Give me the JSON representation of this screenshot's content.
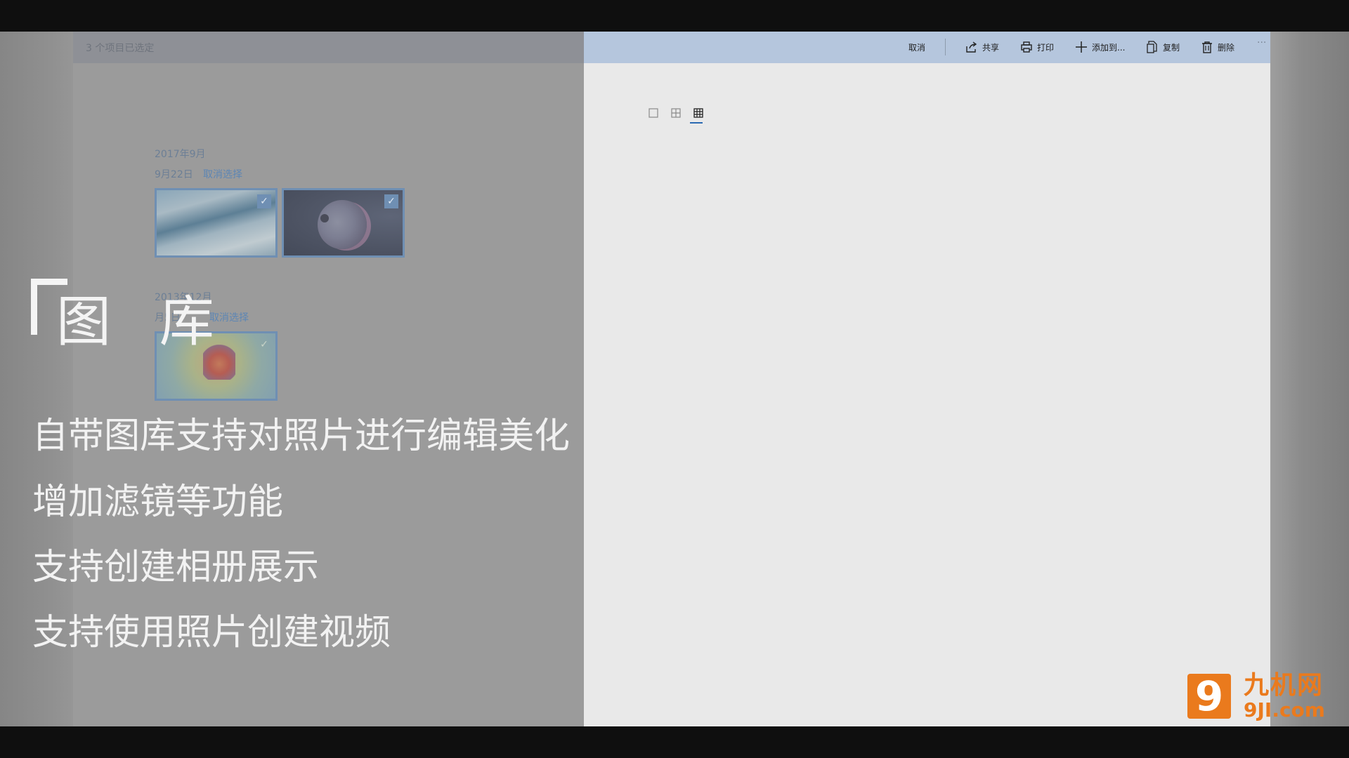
{
  "left_panel": {
    "selected_count": "3 个项目已选定",
    "groups": [
      {
        "title": "2017年9月",
        "day": "9月22日",
        "deselect": "取消选择"
      },
      {
        "title": "2013年12月",
        "day": "月5日",
        "deselect": "取消选择"
      }
    ],
    "check_glyph": "✓"
  },
  "toolbar": {
    "cancel": "取消",
    "share": "共享",
    "print": "打印",
    "add_to": "添加到...",
    "copy": "复制",
    "delete": "删除",
    "more": "···",
    "icons": [
      "share-icon",
      "print-icon",
      "add-icon",
      "copy-icon",
      "delete-icon"
    ]
  },
  "view_toggle": {
    "options": [
      "single-view-icon",
      "medium-grid-icon",
      "small-grid-icon"
    ],
    "active": "small-grid-icon",
    "accent": "#2a69b2"
  },
  "overlay": {
    "title": "图 库",
    "lines": [
      "自带图库支持对照片进行编辑美化",
      "增加滤镜等功能",
      "支持创建相册展示",
      "支持使用照片创建视频"
    ]
  },
  "logo": {
    "mark": "9",
    "cn": "九机网",
    "en": "9JI.com",
    "color": "#ea7a1d"
  }
}
